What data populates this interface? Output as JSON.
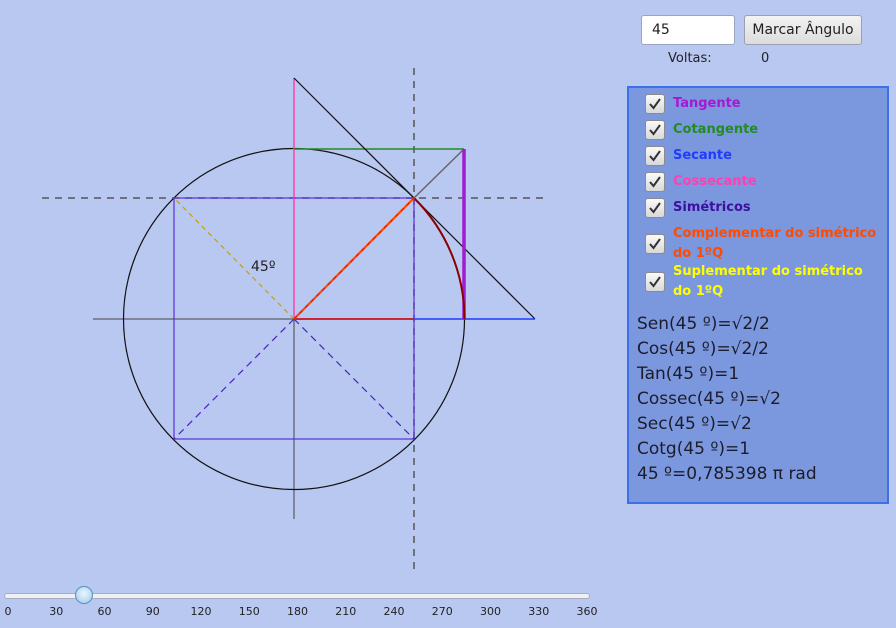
{
  "controls": {
    "angle_value": "45",
    "mark_button_label": "Marcar Ângulo",
    "turns_label": "Voltas:",
    "turns_value": "0"
  },
  "drawing": {
    "angle_label": "45º",
    "angle_degrees": 45
  },
  "options": [
    {
      "label": "Tangente",
      "checked": true,
      "color": "#a21ad1"
    },
    {
      "label": "Cotangente",
      "checked": true,
      "color": "#228b22"
    },
    {
      "label": "Secante",
      "checked": true,
      "color": "#1f3cff"
    },
    {
      "label": "Cossecante",
      "checked": true,
      "color": "#ff3fb4"
    },
    {
      "label": "Simétricos",
      "checked": true,
      "color": "#3d10a0"
    },
    {
      "label": "Complementar do simétrico",
      "label_line2": "do 1ºQ",
      "checked": true,
      "color": "#ff4a00"
    },
    {
      "label": "Suplementar do simétrico",
      "label_line2": "do 1ºQ",
      "checked": true,
      "color": "#ffff00"
    }
  ],
  "values": {
    "sen": "Sen(45 º)=√2/2",
    "cos": "Cos(45 º)=√2/2",
    "tan": "Tan(45 º)=1",
    "cossec": "Cossec(45 º)=√2",
    "sec": "Sec(45 º)=√2",
    "cotg": "Cotg(45 º)=1",
    "rad": "45 º=0,785398 π rad"
  },
  "slider": {
    "value": 45,
    "min": 0,
    "max": 360,
    "ticks": [
      "0",
      "30",
      "60",
      "90",
      "120",
      "150",
      "180",
      "210",
      "240",
      "270",
      "300",
      "330",
      "360"
    ]
  }
}
